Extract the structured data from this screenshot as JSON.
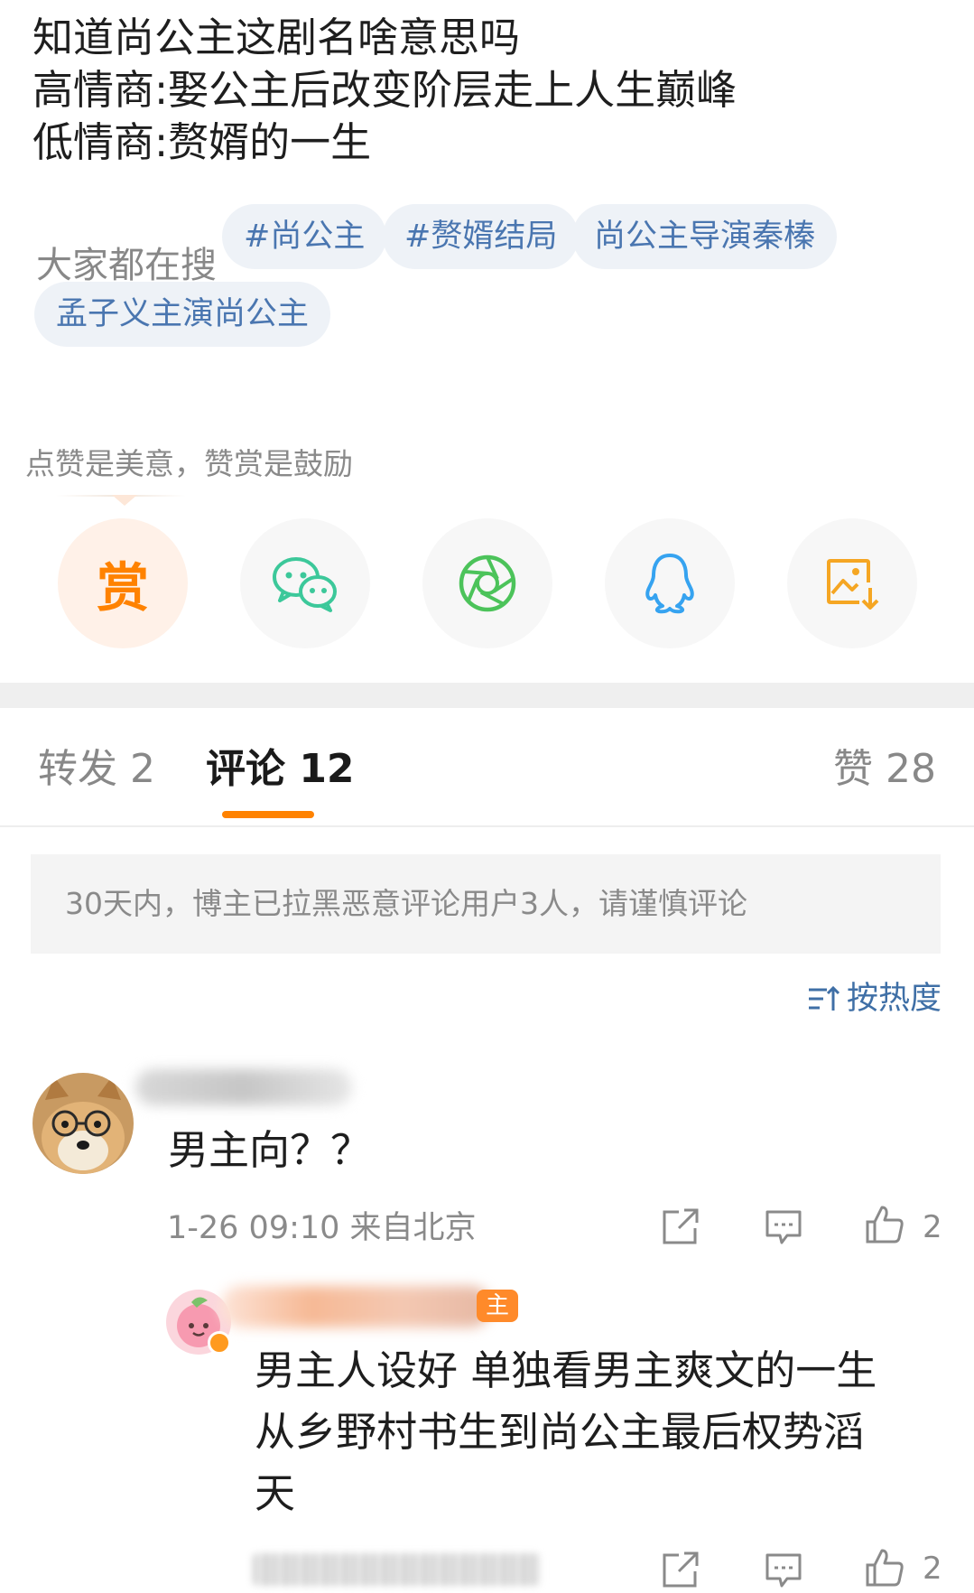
{
  "post": {
    "lines": [
      "知道尚公主这剧名啥意思吗",
      "高情商:娶公主后改变阶层走上人生巅峰",
      "低情商:赘婿的一生"
    ]
  },
  "search": {
    "label": "大家都在搜",
    "chips": [
      "#尚公主",
      "#赘婿结局",
      "尚公主导演秦榛",
      "孟子义主演尚公主"
    ]
  },
  "reward": {
    "tip": "点赞是美意，赞赏是鼓励",
    "reward_glyph": "赏",
    "share_icons": [
      "reward-icon",
      "wechat-icon",
      "moments-icon",
      "qq-icon",
      "save-image-icon"
    ]
  },
  "tabs": {
    "repost": "转发 2",
    "comments": "评论 12",
    "likes": "赞 28"
  },
  "notice": "30天内，博主已拉黑恶意评论用户3人，请谨慎评论",
  "sort": {
    "label": "按热度"
  },
  "comments": [
    {
      "text": "男主向？？",
      "meta": "1-26 09:10 来自北京",
      "like_count": "2"
    }
  ],
  "reply": {
    "owner_tag": "主",
    "lines": [
      "男主人设好 单独看男主爽文的一生",
      "从乡野村书生到尚公主最后权势滔",
      "天"
    ],
    "like_count": "2"
  },
  "colors": {
    "accent": "#ff8200",
    "link": "#4a76b0",
    "wechat": "#3cc89a",
    "moments": "#4cc35a",
    "qq": "#36a3f0",
    "save": "#f5a623"
  }
}
